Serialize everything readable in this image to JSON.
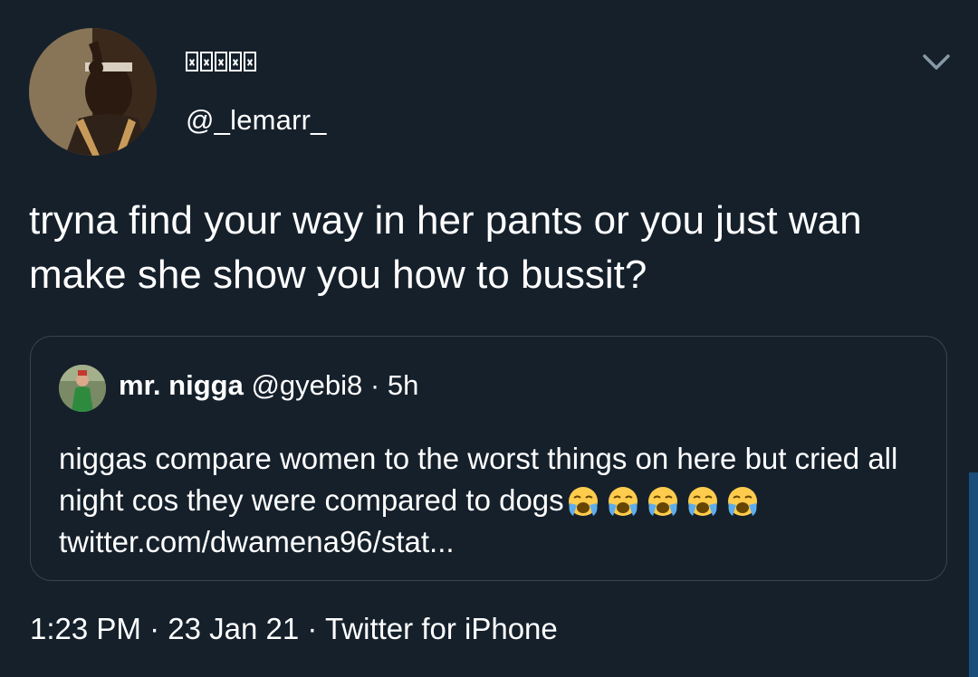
{
  "author": {
    "display_name": "□□□□□",
    "handle": "@_lemarr_"
  },
  "tweet": {
    "text": "tryna find your way in her pants or you just wan make she show you how to bussit?"
  },
  "quoted_tweet": {
    "name": "mr. nigga",
    "handle": "@gyebi8",
    "separator": "·",
    "time": "5h",
    "text": "niggas compare women to the worst things on here but cried all night cos they were compared to dogs",
    "emojis": [
      "loudly-crying-face",
      "loudly-crying-face",
      "loudly-crying-face",
      "loudly-crying-face",
      "loudly-crying-face"
    ],
    "link": "twitter.com/dwamena96/stat..."
  },
  "meta": {
    "time": "1:23 PM",
    "date": "23 Jan 21",
    "source": "Twitter for iPhone",
    "separator": "·"
  },
  "colors": {
    "background": "#15202b",
    "border": "#38444d",
    "chevron": "#8899a6",
    "text": "#ffffff"
  }
}
